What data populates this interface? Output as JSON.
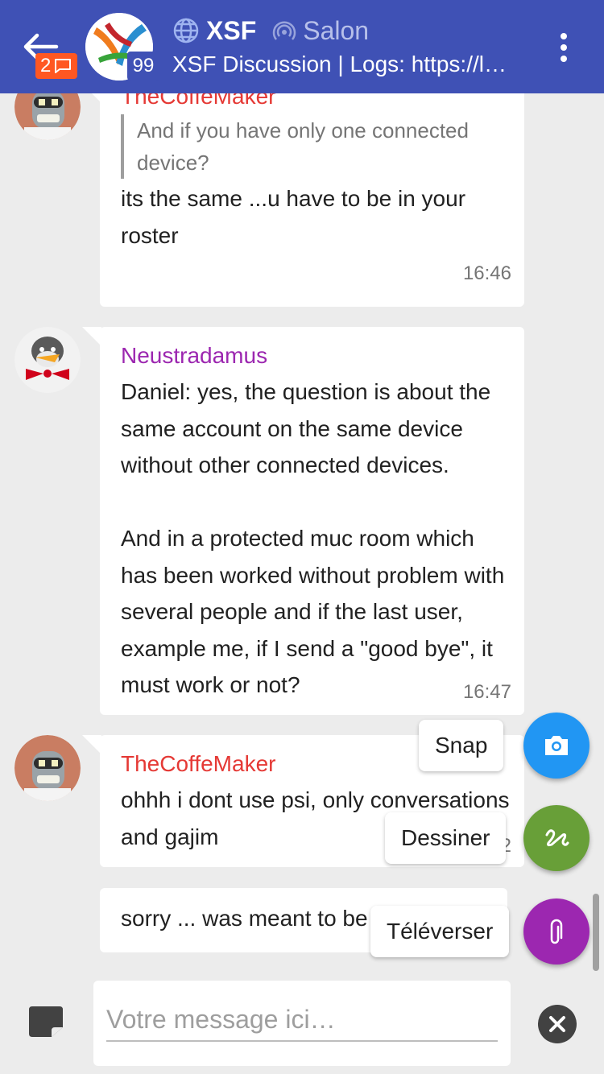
{
  "header": {
    "unread_count": "2",
    "avatar_count": "99",
    "title": "XSF",
    "room_type": "Salon",
    "topic": "XSF Discussion | Logs: https://lo…"
  },
  "messages": [
    {
      "sender": "TheCoffeMaker",
      "quote": "And if you have only one connected device?",
      "text": "its the same ...u have to be in your roster",
      "time": "16:46"
    },
    {
      "sender": "Neustradamus",
      "text": "Daniel: yes, the question is about the same account on the same device without other connected devices.\n\nAnd in a protected muc room which has been worked without problem with several people and if the last user, example me, if I send a \"good bye\", it must work or not?",
      "time": "16:47"
    },
    {
      "sender": "TheCoffeMaker",
      "text": "ohhh i dont use psi, only conversations and gajim",
      "time_partial": "2"
    },
    {
      "text": "sorry ... was meant to be"
    }
  ],
  "fab_menu": {
    "snap_label": "Snap",
    "draw_label": "Dessiner",
    "upload_label": "Téléverser"
  },
  "composer": {
    "placeholder": "Votre message ici…"
  },
  "colors": {
    "toolbar": "#3f51b5",
    "badge": "#ff5722",
    "snap": "#2196f3",
    "draw": "#689f38",
    "upload": "#9c27b0",
    "sender_coffe": "#e53935",
    "sender_neu": "#9c27b0"
  },
  "icons": [
    "back-arrow-icon",
    "chat-bubble-icon",
    "globe-icon",
    "salon-icon",
    "more-vert-icon",
    "camera-icon",
    "draw-icon",
    "paperclip-icon",
    "sticky-note-icon",
    "close-icon"
  ]
}
